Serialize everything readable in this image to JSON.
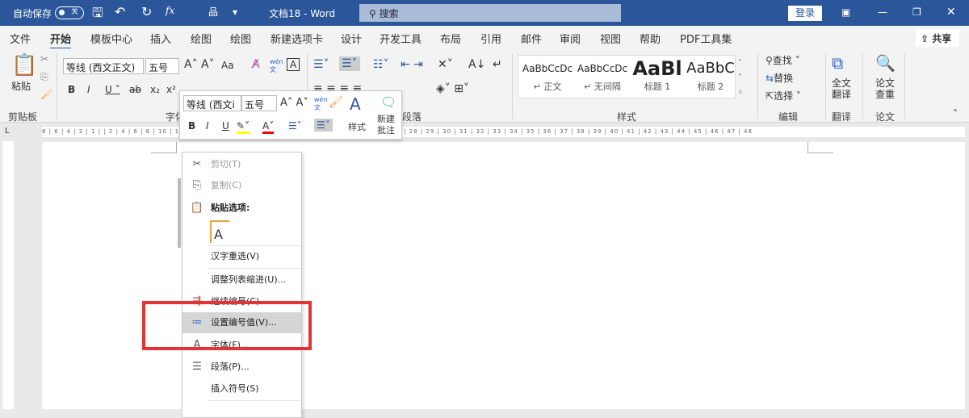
{
  "titlebar": {
    "autosave": "自动保存",
    "autosave_state": "关",
    "doc_title": "文档18  -  Word",
    "search": "搜索",
    "login": "登录",
    "fx": "fx"
  },
  "tabs": [
    "文件",
    "开始",
    "模板中心",
    "插入",
    "绘图",
    "绘图",
    "新建选项卡",
    "设计",
    "开发工具",
    "布局",
    "引用",
    "邮件",
    "审阅",
    "视图",
    "帮助",
    "PDF工具集"
  ],
  "share": "共享",
  "ribbon": {
    "paste": "粘贴",
    "clipboard": "剪贴板",
    "font_name": "等线 (西文正文)",
    "font_size": "五号",
    "font_group": "字体",
    "para_group": "段落",
    "styles": [
      {
        "sample": "AaBbCcDc",
        "name": "↵ 正文"
      },
      {
        "sample": "AaBbCcDc",
        "name": "↵ 无间隔"
      },
      {
        "sample": "AaBl",
        "name": "标题 1"
      },
      {
        "sample": "AaBbC",
        "name": "标题 2"
      }
    ],
    "styles_group": "样式",
    "find": "查找",
    "replace": "替换",
    "select": "选择",
    "edit_group": "编辑",
    "translate": "全文翻译",
    "translate_group": "翻译",
    "paper": "论文查重",
    "paper_group": "论文",
    "wen": "wén 文",
    "aa": "Aa"
  },
  "mini_toolbar": {
    "font_name": "等线 (西文i",
    "font_size": "五号",
    "styles": "样式",
    "new_comment": "新建批注"
  },
  "ruler": "8 | 6 | 4 | 2 | 1 |   | 2 | 4 | 6 | 8 | 10 | 12 | 14 | 16 | 17 | 18 | 19 | 20 | 21 | 22 | 23 | 24 | 25 | 26 | 27 | 28 | 29 | 30 | 31 | 32 | 33 | 34 | 35 | 36 | 37 | 38 | 39 | 40 | 41 | 42 | 43 | 44 | 45 | 46 | 47 | 48",
  "context_menu": [
    {
      "label": "剪切(T)",
      "icon": "scissors-icon",
      "glyph": "✂",
      "disabled": true
    },
    {
      "label": "复制(C)",
      "icon": "copy-icon",
      "glyph": "⎘",
      "disabled": true
    },
    {
      "label": "粘贴选项:",
      "icon": "paste-icon",
      "glyph": "📋",
      "bold": true
    },
    {
      "label": "",
      "icon": "paste-text-only-icon",
      "glyph": "A"
    },
    {
      "label": "汉字重选(V)"
    },
    {
      "label": "调整列表缩进(U)..."
    },
    {
      "label": "继续编号(C)",
      "icon": "continue-numbering-icon",
      "glyph": "⇶"
    },
    {
      "label": "设置编号值(V)...",
      "icon": "set-numbering-value-icon",
      "glyph": "≔",
      "highlight": true
    },
    {
      "label": "字体(F)...",
      "icon": "font-icon",
      "glyph": "A"
    },
    {
      "label": "段落(P)...",
      "icon": "paragraph-icon",
      "glyph": "☰"
    },
    {
      "label": "插入符号(S)"
    }
  ],
  "colors": {
    "accent": "#2b579a",
    "highlight": "#e23434"
  }
}
